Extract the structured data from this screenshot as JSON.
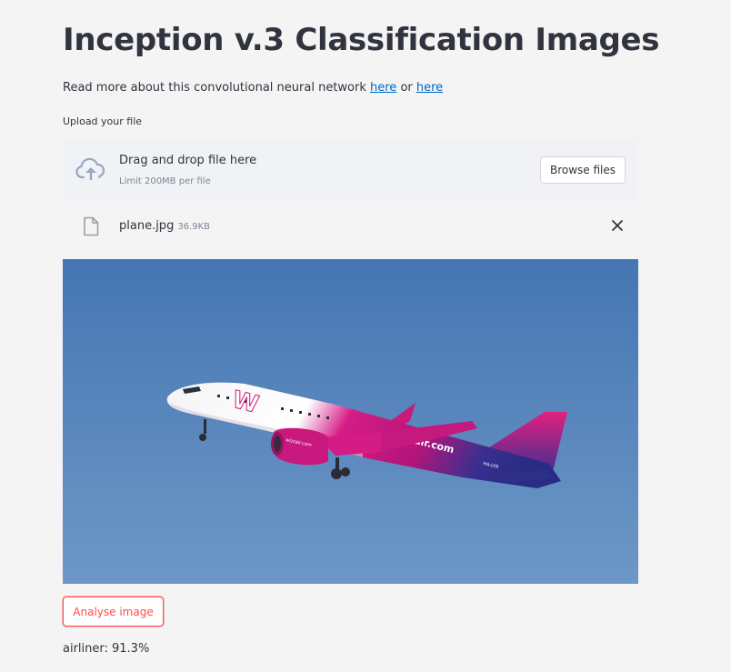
{
  "page": {
    "title": "Inception v.3 Classification Images",
    "intro": {
      "prefix": "Read more about this convolutional neural network ",
      "link1": "here",
      "middle": " or ",
      "link2": "here"
    }
  },
  "uploader": {
    "label": "Upload your file",
    "drop_text": "Drag and drop file here",
    "limit_text": "Limit 200MB per file",
    "browse_label": "Browse files",
    "cloud_icon": "cloud-upload-icon"
  },
  "uploaded_file": {
    "name": "plane.jpg",
    "size": "36.9KB",
    "file_icon": "file-icon",
    "remove_icon": "close-icon"
  },
  "image": {
    "logo_text": "W",
    "brand_text": "wizzair.com",
    "engine_text": "wizzair.com",
    "registration": "HA-LYR"
  },
  "actions": {
    "analyse_label": "Analyse image"
  },
  "result": {
    "text": "airliner: 91.3%"
  },
  "colors": {
    "accent": "#ff4b4b",
    "link": "#0068c9",
    "text": "#31333f",
    "muted": "#808495",
    "dropzone_bg": "#f0f2f6",
    "sky": "#4b7fbc"
  }
}
